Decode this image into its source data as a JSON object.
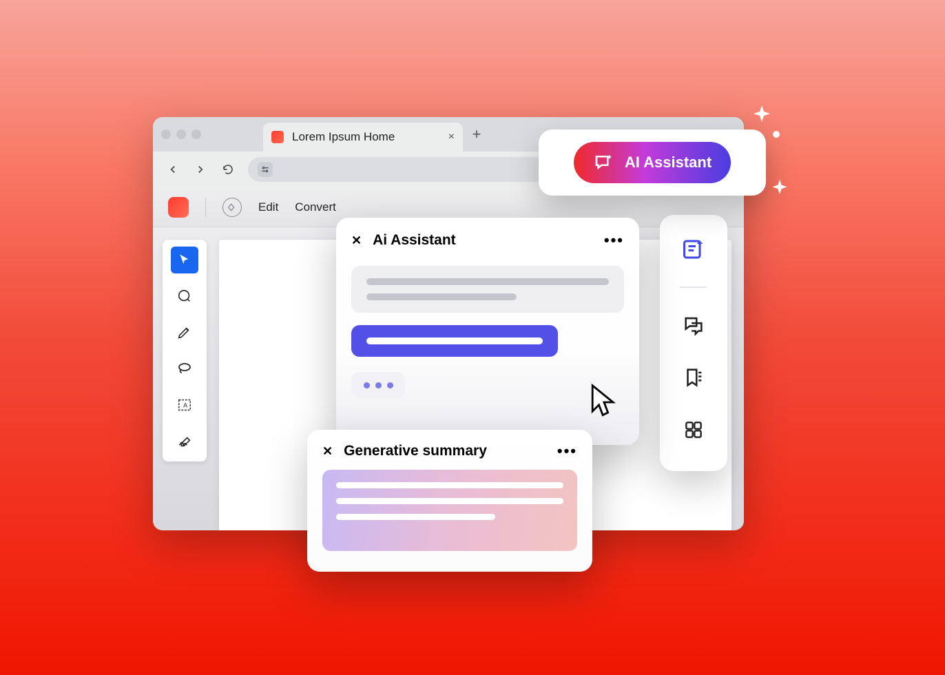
{
  "browser": {
    "tab_title": "Lorem Ipsum Home"
  },
  "app_menu": {
    "edit": "Edit",
    "convert": "Convert"
  },
  "ai_pill": {
    "label": "AI Assistant"
  },
  "assistant_panel": {
    "title": "Ai Assistant"
  },
  "summary_panel": {
    "title": "Generative summary"
  }
}
